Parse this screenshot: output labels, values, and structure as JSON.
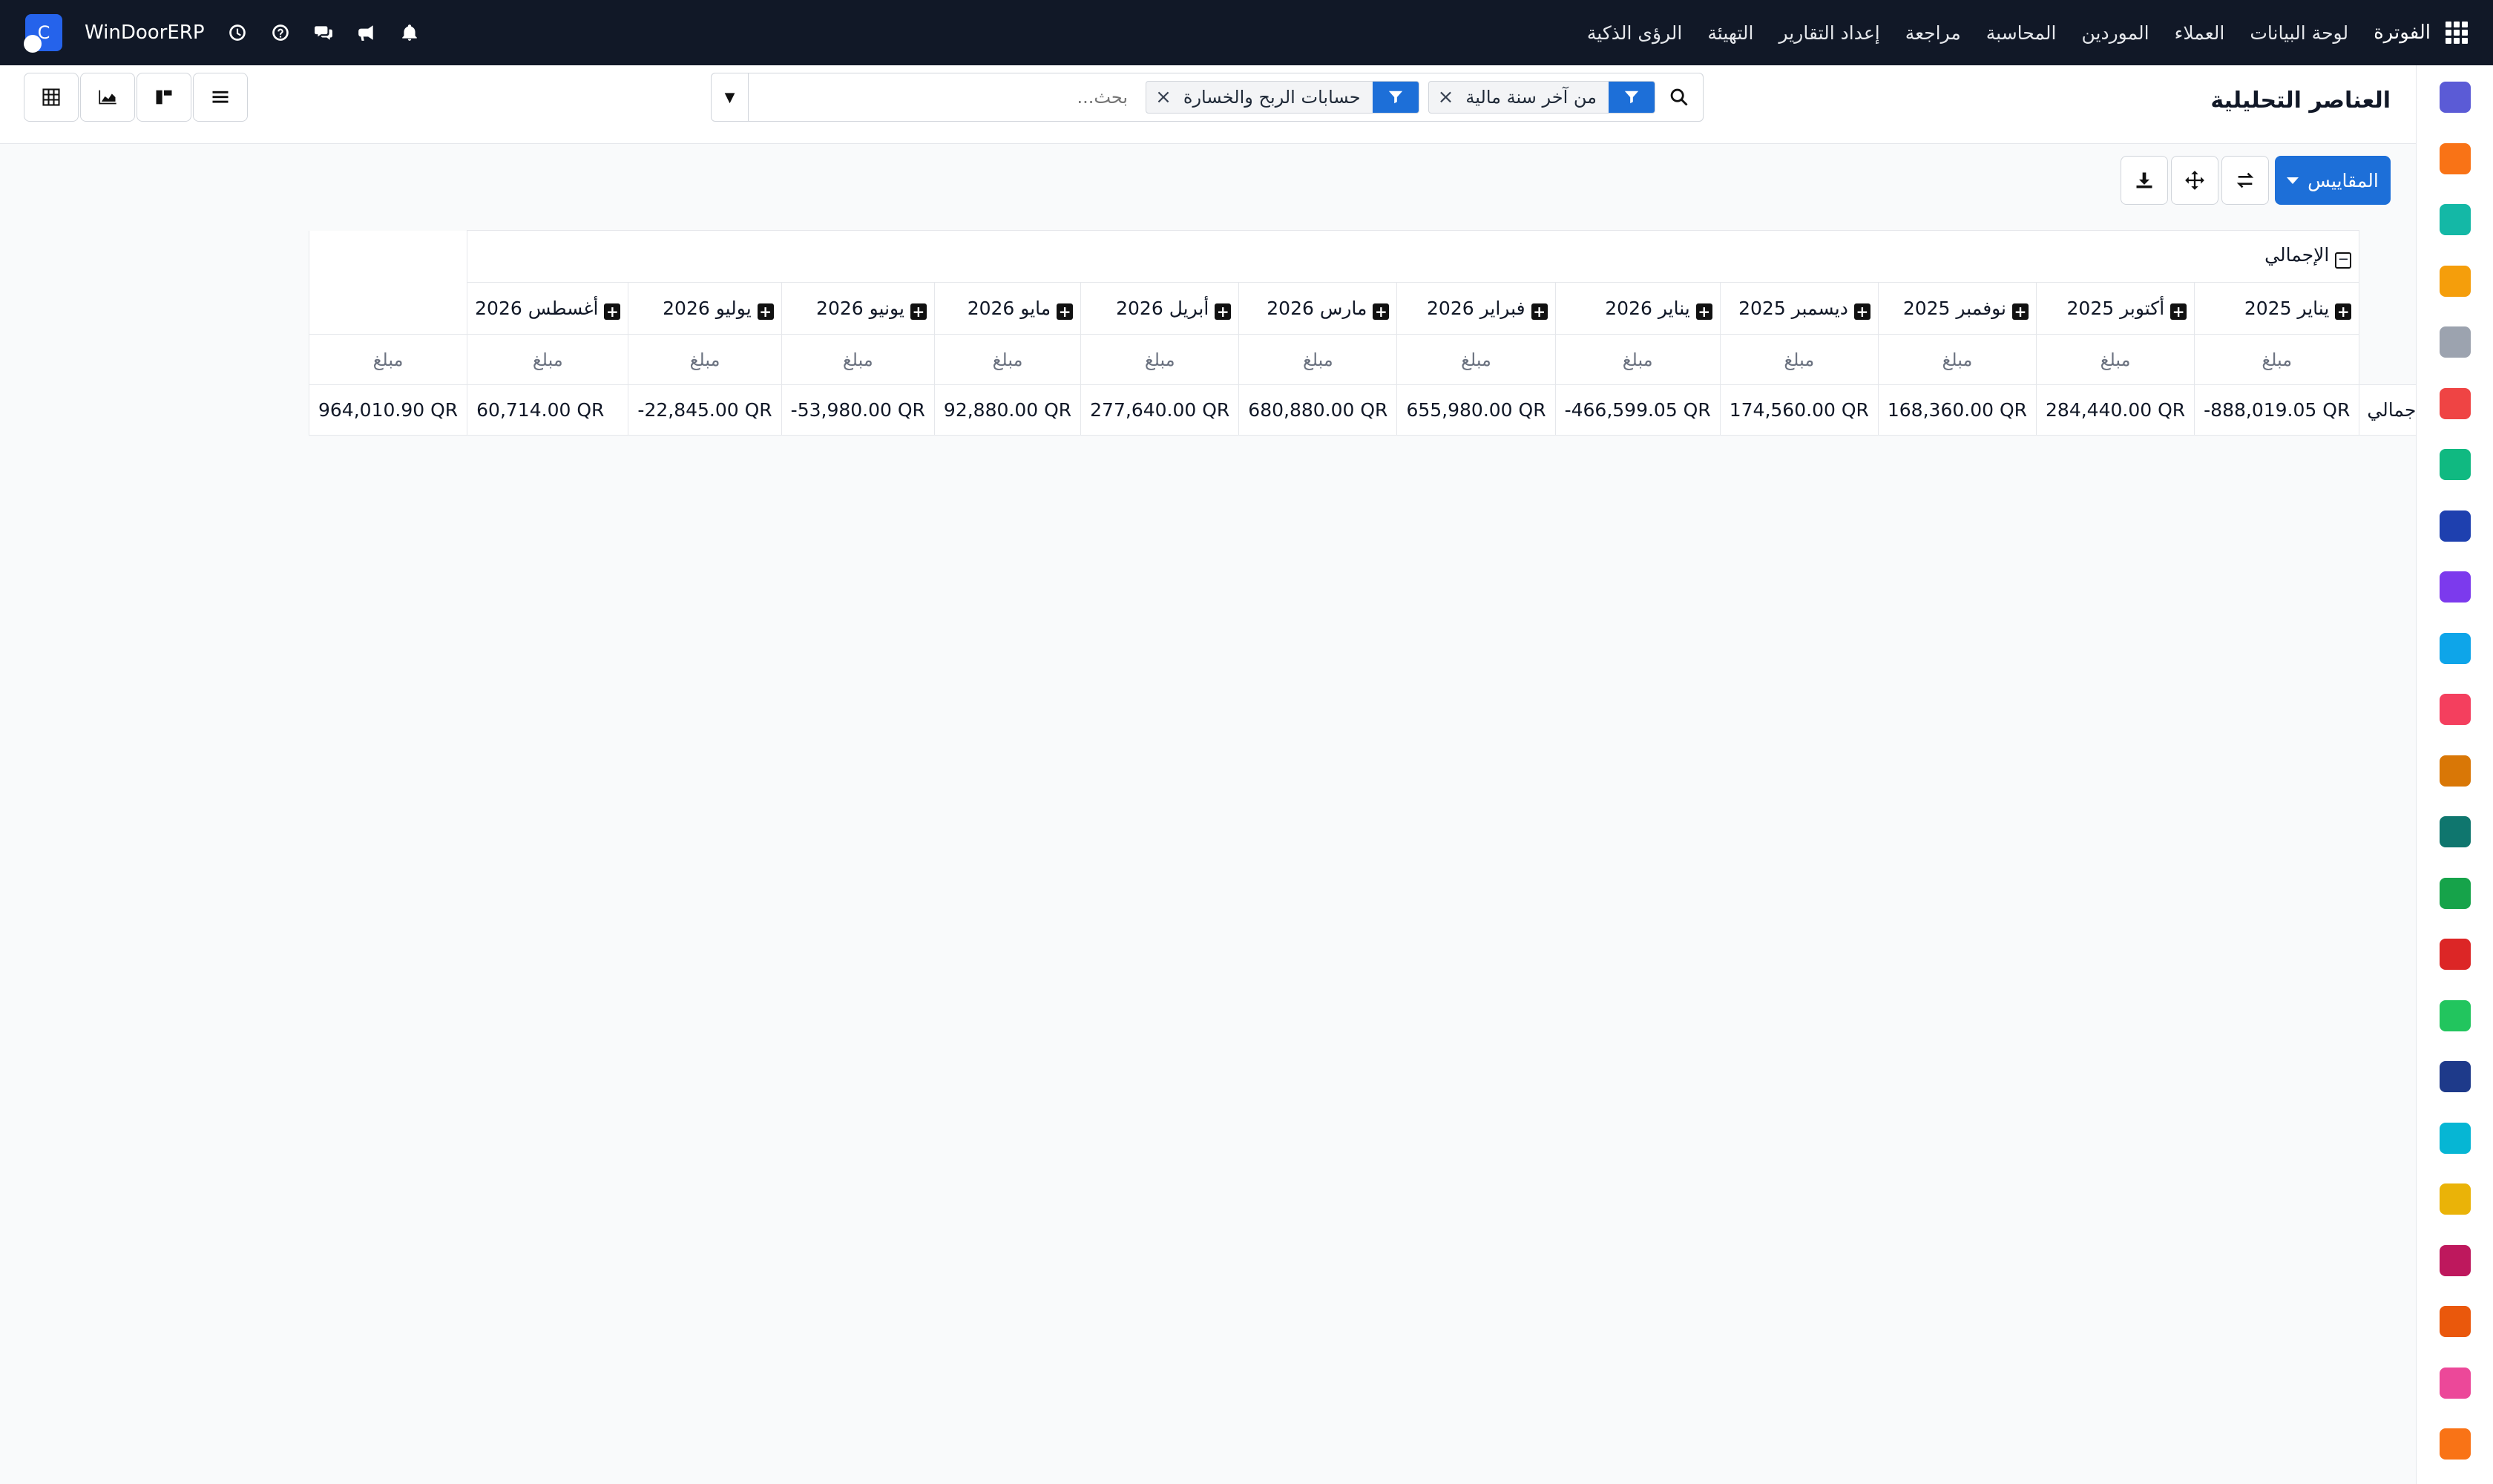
{
  "navbar": {
    "brand": "الفوترة",
    "menu": [
      "لوحة البيانات",
      "العملاء",
      "الموردين",
      "المحاسبة",
      "مراجعة",
      "إعداد التقارير",
      "التهيئة",
      "الرؤى الذكية"
    ],
    "company": "WinDoorERP",
    "logo_letter": "C"
  },
  "control_panel": {
    "title": "العناصر التحليلية",
    "search_placeholder": "بحث...",
    "facets": [
      {
        "label": "من آخر سنة مالية"
      },
      {
        "label": "حسابات الربح والخسارة"
      }
    ]
  },
  "actions": {
    "measures_label": "المقاييس"
  },
  "pivot": {
    "total_header": "الإجمالي",
    "row_header": "الإجمالي",
    "measure_label": "مبلغ",
    "columns": [
      "يناير 2025",
      "أكتوبر 2025",
      "نوفمبر 2025",
      "ديسمبر 2025",
      "يناير 2026",
      "فبراير 2026",
      "مارس 2026",
      "أبريل 2026",
      "مايو 2026",
      "يونيو 2026",
      "يوليو 2026",
      "أغسطس 2026"
    ],
    "values": [
      "-888,019.05 QR",
      "284,440.00 QR",
      "168,360.00 QR",
      "174,560.00 QR",
      "-466,599.05 QR",
      "655,980.00 QR",
      "680,880.00 QR",
      "277,640.00 QR",
      "92,880.00 QR",
      "-53,980.00 QR",
      "-22,845.00 QR",
      "60,714.00 QR"
    ],
    "grand_total": "964,010.90 QR"
  },
  "sidebar_apps": [
    {
      "icon": "mail-app-icon",
      "color": "#5b5bd6"
    },
    {
      "icon": "chat-app-icon",
      "color": "#f97316"
    },
    {
      "icon": "check-app-icon",
      "color": "#14b8a6"
    },
    {
      "icon": "chart-app-icon",
      "color": "#f59e0b"
    },
    {
      "icon": "box-app-icon",
      "color": "#9ca3af"
    },
    {
      "icon": "image-app-icon",
      "color": "#ef4444"
    },
    {
      "icon": "task-app-icon",
      "color": "#10b981"
    },
    {
      "icon": "book-app-icon",
      "color": "#1e40af"
    },
    {
      "icon": "cube-app-icon",
      "color": "#7c3aed"
    },
    {
      "icon": "dollar-app-icon",
      "color": "#0ea5e9"
    },
    {
      "icon": "people-app-icon",
      "color": "#f43f5e"
    },
    {
      "icon": "calendar-app-icon",
      "color": "#d97706"
    },
    {
      "icon": "pen-app-icon",
      "color": "#0f766e"
    },
    {
      "icon": "contact-app-icon",
      "color": "#16a34a"
    },
    {
      "icon": "dashboard-app-icon",
      "color": "#dc2626"
    },
    {
      "icon": "whatsapp-app-icon",
      "color": "#22c55e"
    },
    {
      "icon": "clock-app-icon",
      "color": "#1e3a8a"
    },
    {
      "icon": "wave-app-icon",
      "color": "#06b6d4"
    },
    {
      "icon": "send-app-icon",
      "color": "#eab308"
    },
    {
      "icon": "bar-app-icon",
      "color": "#be185d"
    },
    {
      "icon": "hex-app-icon",
      "color": "#ea580c"
    },
    {
      "icon": "pie-app-icon",
      "color": "#ec4899"
    },
    {
      "icon": "gear-app-icon",
      "color": "#f97316"
    }
  ]
}
